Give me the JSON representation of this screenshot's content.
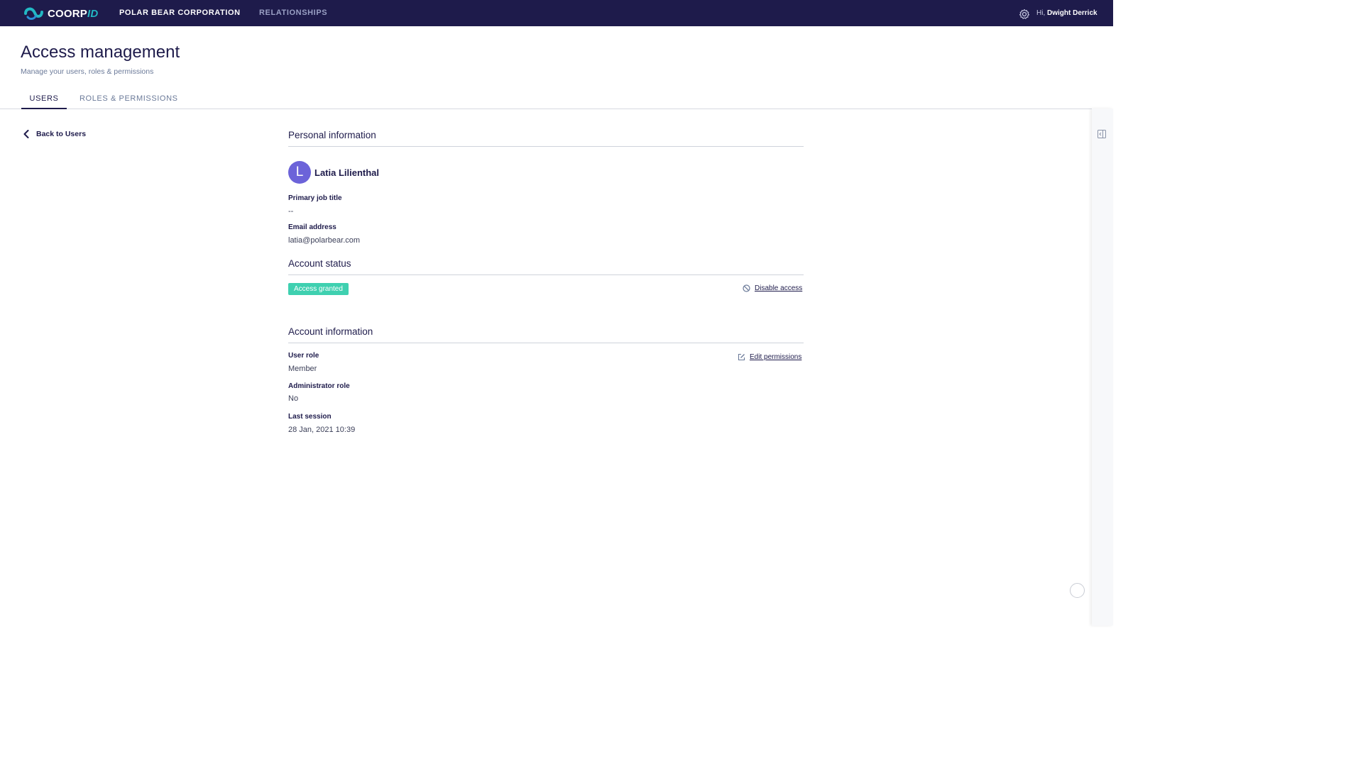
{
  "header": {
    "logo_text": "COORP",
    "logo_text_accent": "ID",
    "nav_org": "POLAR BEAR CORPORATION",
    "nav_relationships": "RELATIONSHIPS",
    "greeting_prefix": "Hi,",
    "user_name": "Dwight Derrick"
  },
  "page": {
    "title": "Access management",
    "subtitle": "Manage your users, roles & permissions"
  },
  "tabs": [
    {
      "label": "USERS",
      "active": true
    },
    {
      "label": "ROLES & PERMISSIONS",
      "active": false
    }
  ],
  "back_link": "Back to Users",
  "personal": {
    "section_title": "Personal information",
    "avatar_initial": "L",
    "name": "Latia Lilienthal",
    "job_title_label": "Primary job title",
    "job_title_value": "--",
    "email_label": "Email address",
    "email_value": "latia@polarbear.com"
  },
  "status": {
    "section_title": "Account status",
    "badge": "Access granted",
    "disable_link": "Disable access"
  },
  "account": {
    "section_title": "Account information",
    "user_role_label": "User role",
    "user_role_value": "Member",
    "admin_role_label": "Administrator role",
    "admin_role_value": "No",
    "last_session_label": "Last session",
    "last_session_value": "28 Jan, 2021 10:39",
    "edit_link": "Edit permissions"
  },
  "colors": {
    "nav_background": "#1e1b4b",
    "badge": "#3fd0b0",
    "avatar": "#6c63d9"
  }
}
